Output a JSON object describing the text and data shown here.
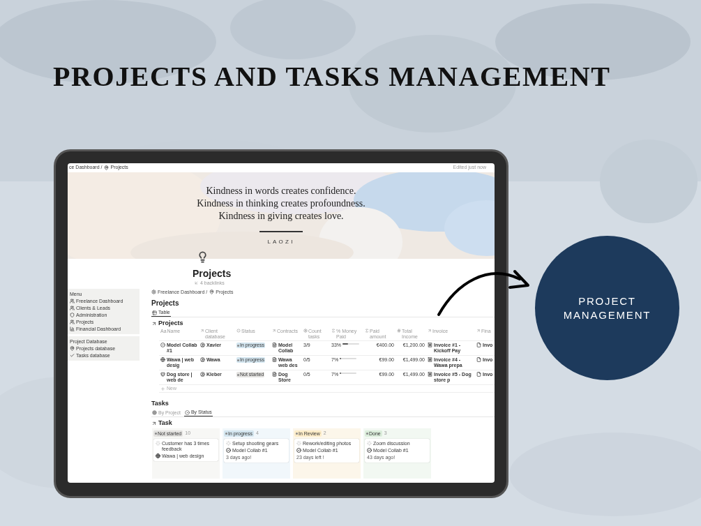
{
  "title": "PROJECTS AND TASKS MANAGEMENT",
  "badge": {
    "lines": [
      "PROJECT",
      "MANAGEMENT"
    ]
  },
  "tablet": {
    "topbar": {
      "breadcrumb": [
        "ce Dashboard /",
        "Projects"
      ],
      "status": "Edited just now"
    },
    "cover": {
      "quote_lines": [
        "Kindness in words creates confidence.",
        "Kindness in thinking creates profoundness.",
        "Kindness in giving creates love."
      ],
      "author": "LAOZI"
    },
    "page": {
      "title": "Projects",
      "backlinks": "4 backlinks"
    },
    "sidebar": [
      {
        "heading": "Menu",
        "items": [
          "Freelance Dashboard",
          "Clients & Leads",
          "Administration",
          "Projects",
          "Financial Dashboard"
        ]
      },
      {
        "heading": "Project Database",
        "items": [
          "Projects database",
          "Tasks database"
        ]
      }
    ],
    "breadcrumb": [
      "Freelance Dashboard /",
      "Projects"
    ],
    "projects": {
      "heading": "Projects",
      "tabs": [
        {
          "label": "Table",
          "selected": true
        }
      ],
      "table": {
        "title": "Projects",
        "columns": [
          {
            "prefix": "Aa",
            "label": "Name"
          },
          {
            "label": "Client database"
          },
          {
            "label": "Status"
          },
          {
            "label": "Contracts"
          },
          {
            "label": "Count tasks"
          },
          {
            "label": "% Money Paid"
          },
          {
            "label": "Paid amount"
          },
          {
            "label": "Total Income"
          },
          {
            "label": "Invoice"
          },
          {
            "label": "Fina"
          }
        ],
        "rows": [
          {
            "cells": [
              {
                "kind": "text",
                "text": "Model Collab #1"
              },
              {
                "kind": "text",
                "text": "Xavier"
              },
              {
                "kind": "status",
                "text": "In progress",
                "color": "#d3e5ef"
              },
              {
                "kind": "text",
                "text": "Model Collab"
              },
              {
                "kind": "text",
                "text": "3/9"
              },
              {
                "kind": "progress",
                "text": "33%",
                "level": 0.33
              },
              {
                "kind": "text",
                "text": "€400.00"
              },
              {
                "kind": "text",
                "text": "€1,200.00"
              },
              {
                "kind": "text",
                "text": "Invoice #1 - Kickoff Pay"
              },
              {
                "kind": "text",
                "text": "Invo"
              }
            ]
          },
          {
            "cells": [
              {
                "kind": "text",
                "text": "Wawa | web desig"
              },
              {
                "kind": "text",
                "text": "Wawa"
              },
              {
                "kind": "status",
                "text": "In progress",
                "color": "#d3e5ef"
              },
              {
                "kind": "text",
                "text": "Wawa web des"
              },
              {
                "kind": "text",
                "text": "0/5"
              },
              {
                "kind": "progress",
                "text": "7%",
                "level": 0.07
              },
              {
                "kind": "text",
                "text": "€99.00"
              },
              {
                "kind": "text",
                "text": "€1,499.00"
              },
              {
                "kind": "text",
                "text": "Invoice #4 - Wawa prepa"
              },
              {
                "kind": "text",
                "text": "Invo"
              }
            ]
          },
          {
            "cells": [
              {
                "kind": "text",
                "text": "Dog store | web de"
              },
              {
                "kind": "text",
                "text": "Kleber"
              },
              {
                "kind": "status",
                "text": "Not started",
                "color": "#e3e2e0"
              },
              {
                "kind": "text",
                "text": "Dog Store"
              },
              {
                "kind": "text",
                "text": "0/5"
              },
              {
                "kind": "progress",
                "text": "7%",
                "level": 0.07
              },
              {
                "kind": "text",
                "text": "€99.00"
              },
              {
                "kind": "text",
                "text": "€1,499.00"
              },
              {
                "kind": "text",
                "text": "Invoice #5 - Dog store p"
              },
              {
                "kind": "text",
                "text": "Invo"
              }
            ]
          }
        ],
        "new_label": "New"
      }
    },
    "tasks": {
      "heading": "Tasks",
      "tabs": [
        {
          "label": "By Project",
          "selected": false
        },
        {
          "label": "By Status",
          "selected": true
        }
      ],
      "board_title": "Task",
      "columns": [
        {
          "label": "Not started",
          "count": "10",
          "color": "#e3e2e0",
          "cards": [
            {
              "title": "Customer has 3 times feedback",
              "project": "Wawa | web design"
            }
          ]
        },
        {
          "label": "In progress",
          "count": "4",
          "color": "#d3e5ef",
          "cards": [
            {
              "title": "Setup shooting gears",
              "project": "Model Collab #1",
              "date": "3 days ago!"
            }
          ]
        },
        {
          "label": "In Review",
          "count": "2",
          "color": "#fdecc8",
          "cards": [
            {
              "title": "Rework/editing photos",
              "project": "Model Collab #1",
              "date": "23 days left !"
            }
          ]
        },
        {
          "label": "Done",
          "count": "3",
          "color": "#dbeddb",
          "cards": [
            {
              "title": "Zoom discussion",
              "project": "Model Collab #1",
              "date": "43 days ago!"
            }
          ]
        }
      ]
    }
  }
}
